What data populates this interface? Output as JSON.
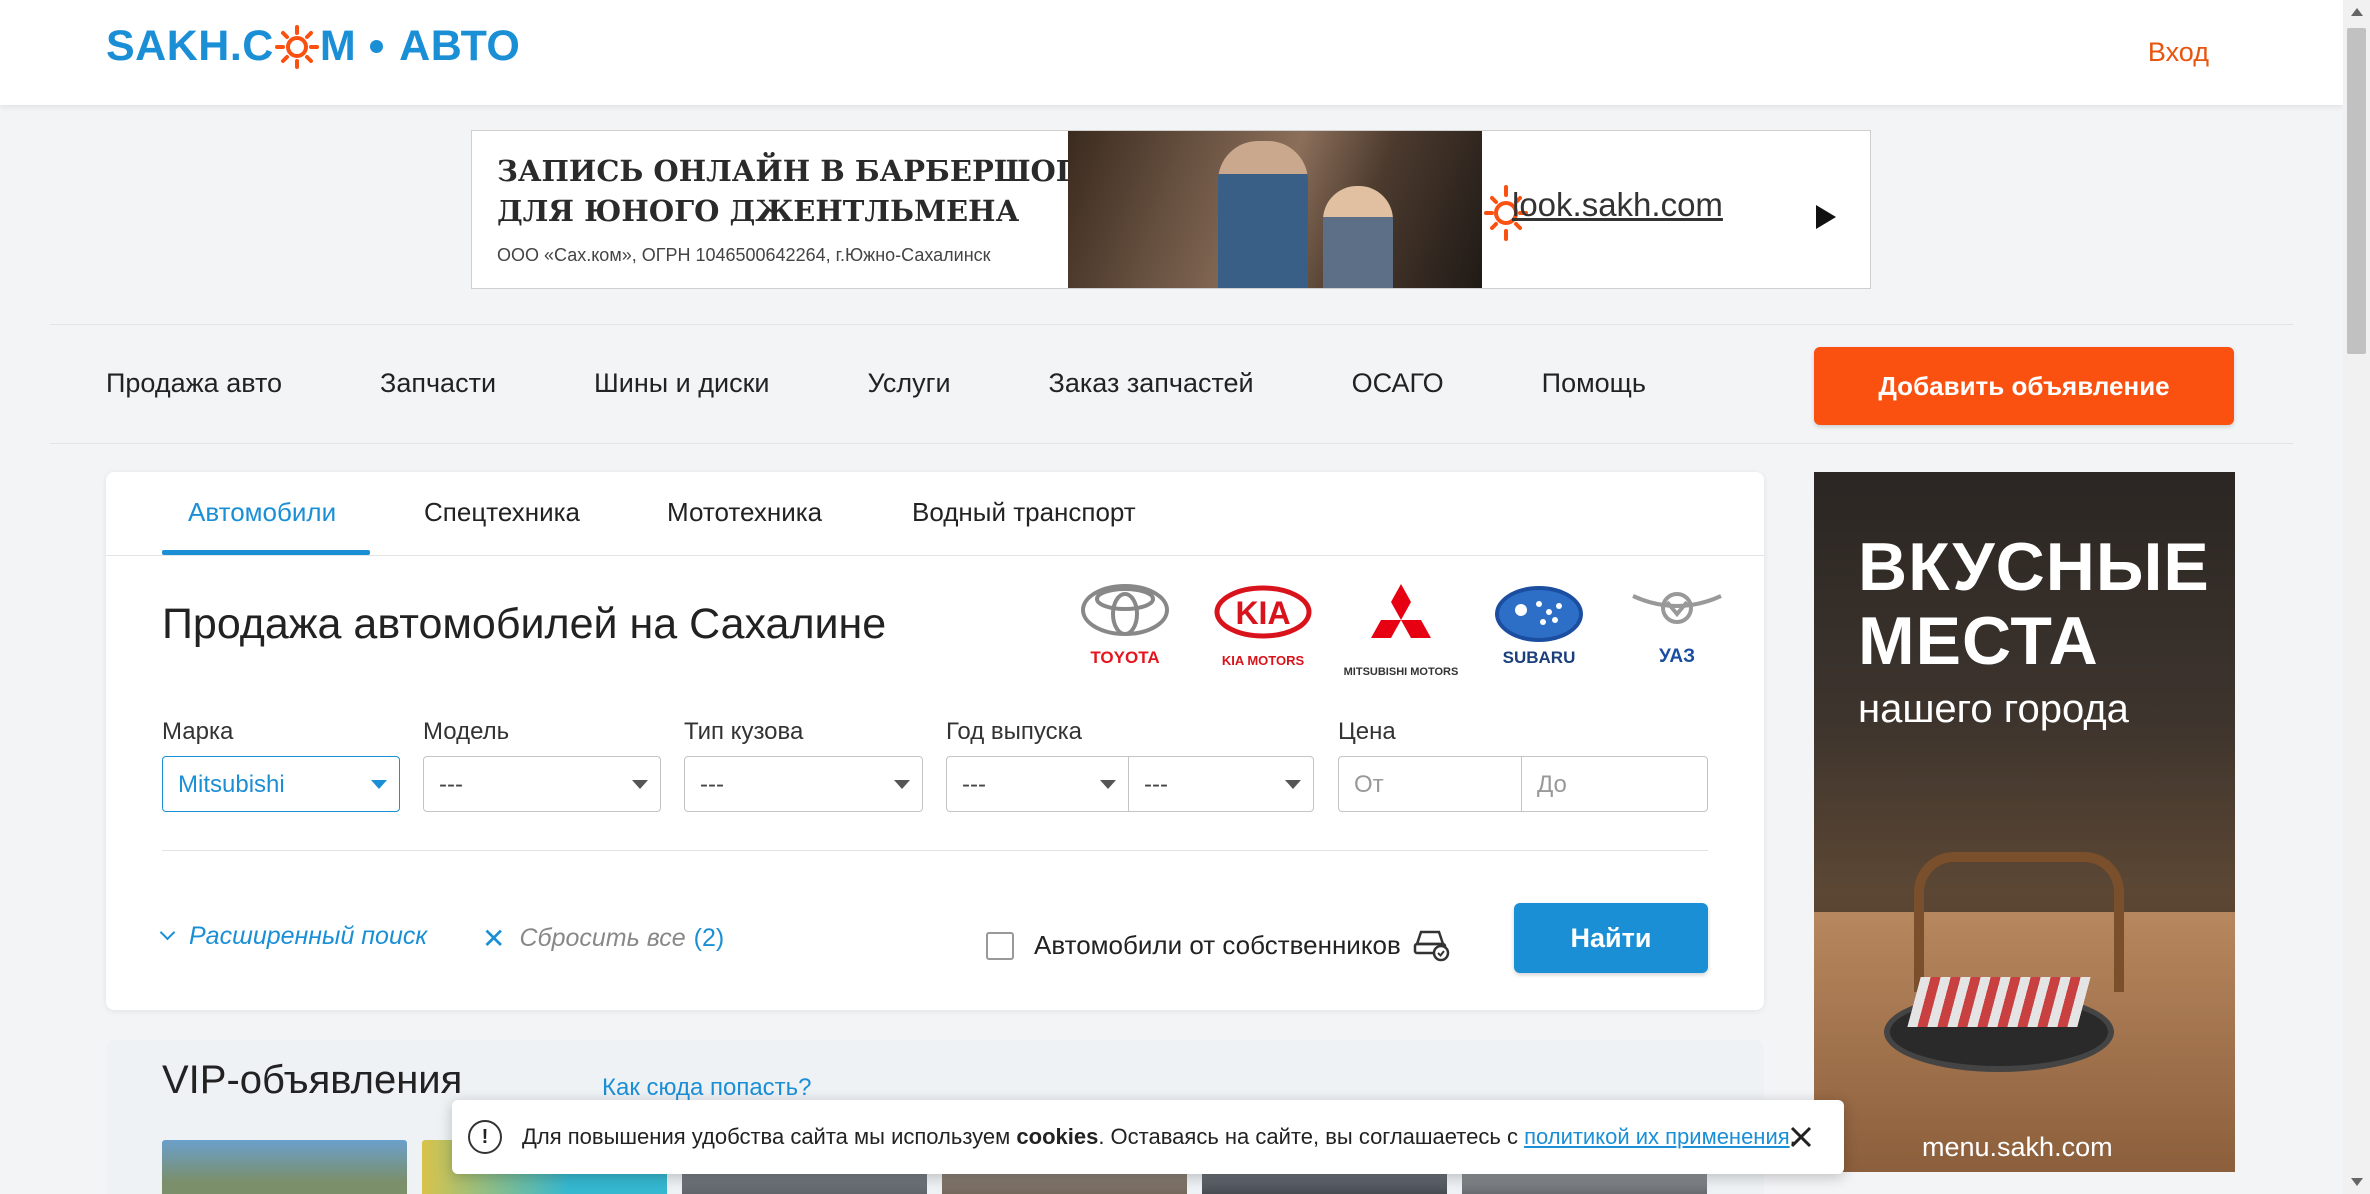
{
  "header": {
    "logo_main": "SAKH.C",
    "logo_m": "M",
    "logo_sub": "АВТО",
    "login": "Вход",
    "brand_color": "#1b8fd6",
    "accent_color": "#fa5010"
  },
  "banner": {
    "line1": "ЗАПИСЬ ОНЛАЙН В БАРБЕРШОП",
    "line2": "ДЛЯ ЮНОГО ДЖЕНТЛЬМЕНА",
    "legal": "ООО «Сах.ком», ОГРН 1046500642264, г.Южно-Сахалинск",
    "site": "look.sakh.com"
  },
  "nav": {
    "items": [
      "Продажа авто",
      "Запчасти",
      "Шины и диски",
      "Услуги",
      "Заказ запчастей",
      "ОСАГО",
      "Помощь"
    ],
    "add_button": "Добавить объявление"
  },
  "search": {
    "tabs": [
      "Автомобили",
      "Спецтехника",
      "Мототехника",
      "Водный транспорт"
    ],
    "active_tab": "Автомобили",
    "title": "Продажа автомобилей на Сахалине",
    "brands": [
      "TOYOTA",
      "KIA MOTORS",
      "MITSUBISHI MOTORS",
      "SUBARU",
      "УАЗ"
    ],
    "labels": {
      "make": "Марка",
      "model": "Модель",
      "body": "Тип кузова",
      "year": "Год выпуска",
      "price": "Цена"
    },
    "values": {
      "make": "Mitsubishi",
      "model": "---",
      "body": "---",
      "year_from": "---",
      "year_to": "---"
    },
    "placeholders": {
      "price_from": "От",
      "price_to": "До"
    },
    "advanced": "Расширенный поиск",
    "reset": "Сбросить все",
    "reset_count": "(2)",
    "owners_only": "Автомобили от собственников",
    "find": "Найти"
  },
  "vip": {
    "title": "VIP-объявления",
    "how": "Как сюда попасть?"
  },
  "side_ad": {
    "line1": "ВКУСНЫЕ",
    "line2": "МЕСТА",
    "line3": "нашего города",
    "url": "menu.sakh.com"
  },
  "cookie": {
    "text_before": "Для повышения удобства сайта мы используем ",
    "bold": "cookies",
    "text_mid": ". Оставаясь на сайте, вы соглашаетесь с ",
    "link": "политикой их применения",
    "text_end": "."
  }
}
